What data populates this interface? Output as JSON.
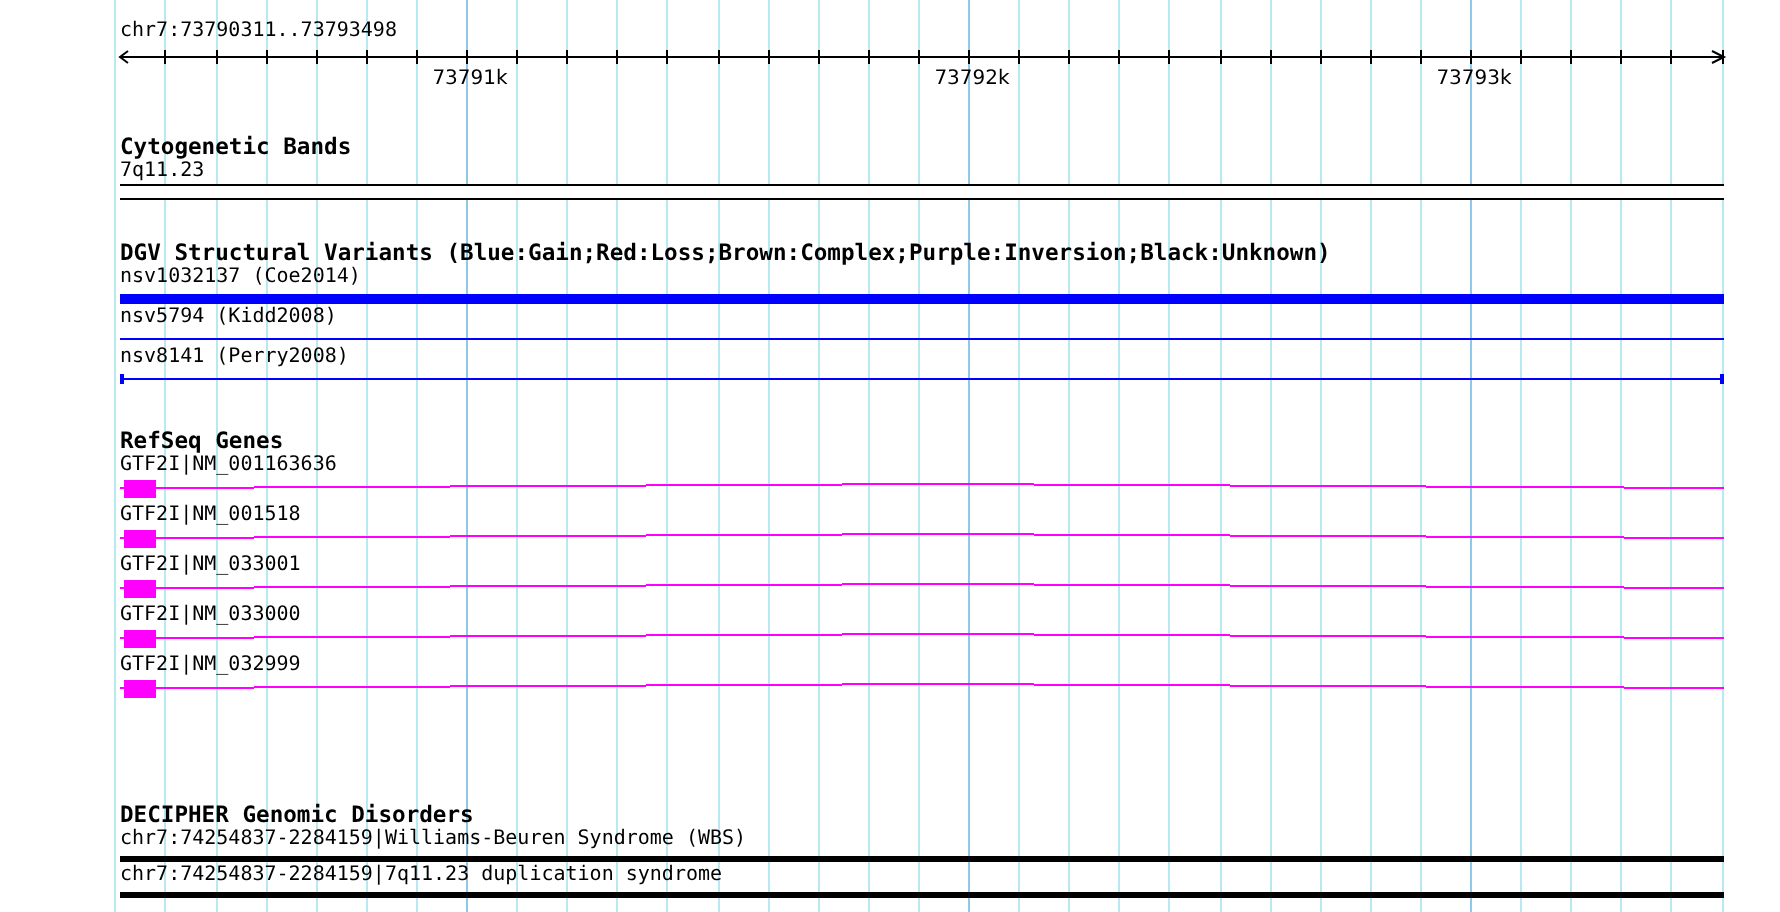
{
  "ruler": {
    "range": "chr7:73790311..73793498",
    "tick_labels": [
      "73791k",
      "73792k",
      "73793k"
    ]
  },
  "tracks": [
    {
      "kind": "bands",
      "title": "Cytogenetic Bands",
      "items": [
        {
          "label": "7q11.23"
        }
      ]
    },
    {
      "kind": "variants",
      "title": "DGV Structural Variants (Blue:Gain;Red:Loss;Brown:Complex;Purple:Inversion;Black:Unknown)",
      "items": [
        {
          "label": "nsv1032137 (Coe2014)",
          "kind": "thick",
          "color": "#0000ff"
        },
        {
          "label": "nsv5794 (Kidd2008)",
          "kind": "thin",
          "color": "#0000ff"
        },
        {
          "label": "nsv8141 (Perry2008)",
          "kind": "capped",
          "color": "#0000ff"
        }
      ]
    },
    {
      "kind": "genes",
      "title": "RefSeq Genes",
      "items": [
        {
          "label": "GTF2I|NM_001163636"
        },
        {
          "label": "GTF2I|NM_001518"
        },
        {
          "label": "GTF2I|NM_033001"
        },
        {
          "label": "GTF2I|NM_033000"
        },
        {
          "label": "GTF2I|NM_032999"
        }
      ]
    },
    {
      "kind": "disorders",
      "title": "DECIPHER Genomic Disorders",
      "items": [
        {
          "label": "chr7:74254837-2284159|Williams-Beuren Syndrome (WBS)"
        },
        {
          "label": "chr7:74254837-2284159|7q11.23 duplication syndrome"
        }
      ]
    }
  ]
}
